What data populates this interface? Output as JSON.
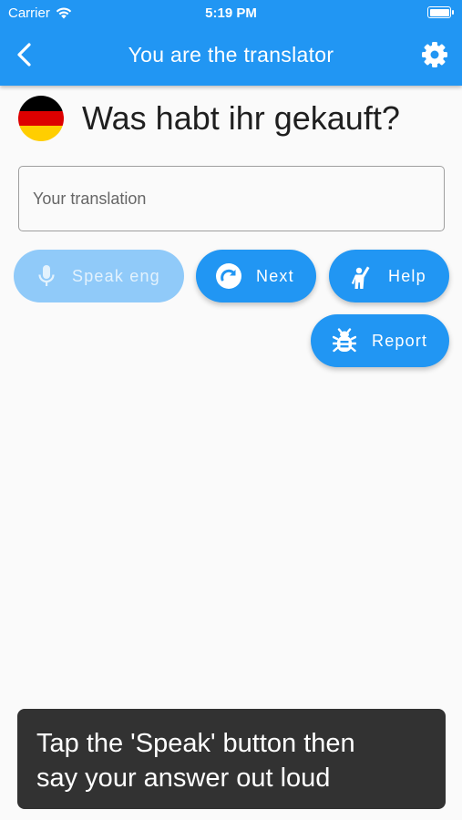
{
  "status_bar": {
    "carrier": "Carrier",
    "time": "5:19 PM"
  },
  "app_bar": {
    "title": "You are the translator",
    "back_icon": "chevron-left-icon",
    "settings_icon": "gear-icon",
    "color": "#2196f3"
  },
  "question": {
    "flag": "germany-flag-icon",
    "flag_colors": [
      "#000000",
      "#dd0000",
      "#ffce00"
    ],
    "text": "Was habt ihr gekauft?"
  },
  "translation_input": {
    "placeholder": "Your translation",
    "value": ""
  },
  "buttons": {
    "speak": {
      "label": "Speak eng",
      "icon": "microphone-icon",
      "disabled": true
    },
    "next": {
      "label": "Next",
      "icon": "redo-icon"
    },
    "help": {
      "label": "Help",
      "icon": "person-raising-hand-icon"
    },
    "report": {
      "label": "Report",
      "icon": "bug-icon"
    }
  },
  "toast": {
    "line1": "Tap the 'Speak' button then",
    "line2": "say your answer out loud"
  }
}
